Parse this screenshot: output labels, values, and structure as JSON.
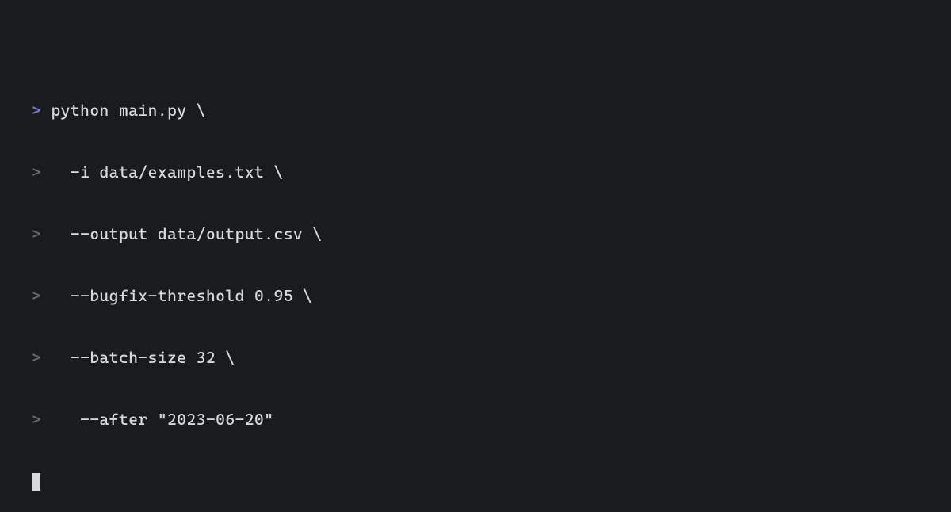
{
  "terminal": {
    "prompt_primary": ">",
    "prompt_continuation": ">",
    "lines": [
      {
        "prompt_style": "primary",
        "text": " python main.py \\"
      },
      {
        "prompt_style": "cont",
        "text": "   -i data/examples.txt \\"
      },
      {
        "prompt_style": "cont",
        "text": "   --output data/output.csv \\"
      },
      {
        "prompt_style": "cont",
        "text": "   --bugfix-threshold 0.95 \\"
      },
      {
        "prompt_style": "cont",
        "text": "   --batch-size 32 \\"
      },
      {
        "prompt_style": "cont",
        "text": "    --after \"2023-06-20\""
      }
    ]
  }
}
